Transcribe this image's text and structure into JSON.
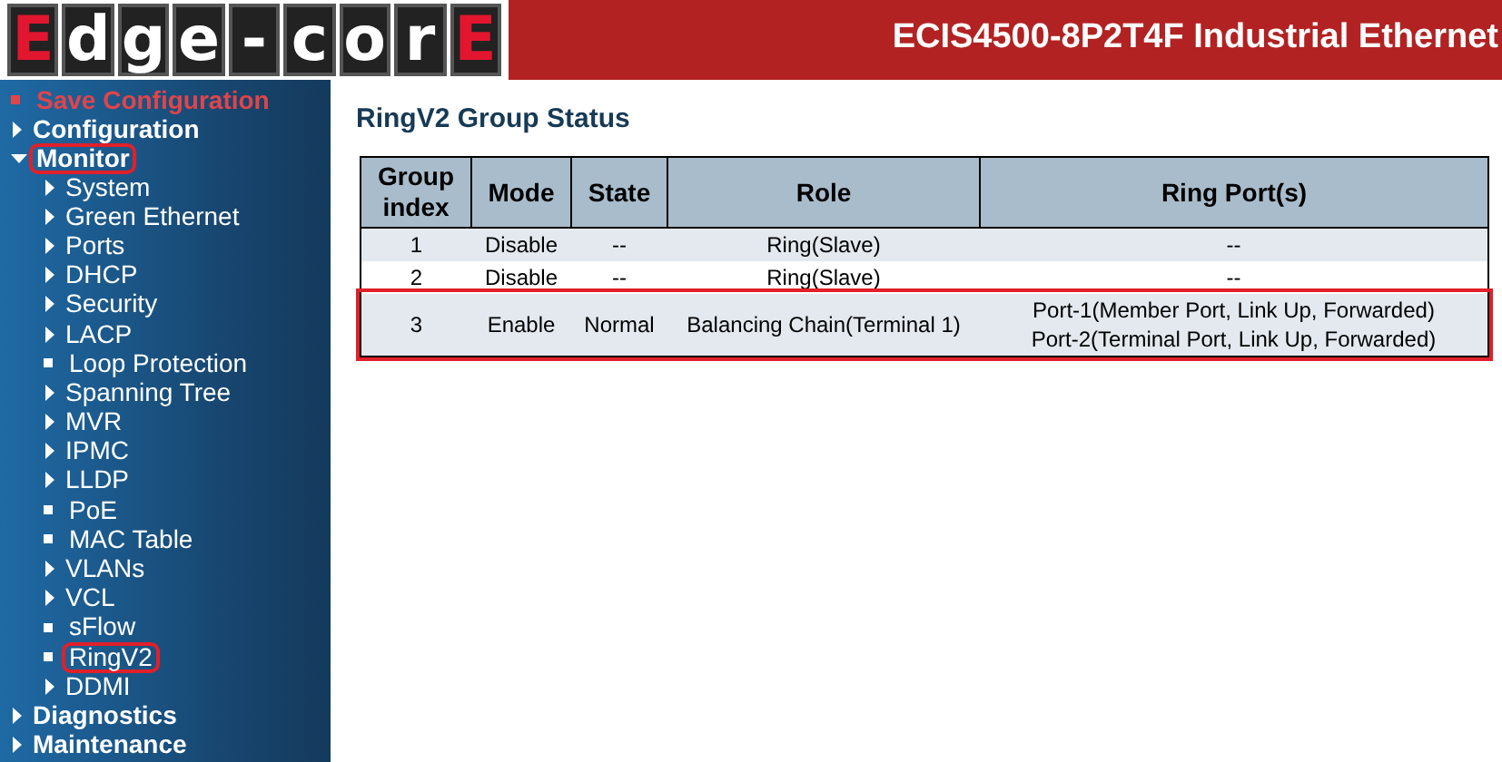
{
  "header": {
    "logo": [
      {
        "letter": "E",
        "accent": true
      },
      {
        "letter": "d",
        "accent": false
      },
      {
        "letter": "g",
        "accent": false
      },
      {
        "letter": "e",
        "accent": false
      },
      {
        "letter": "-",
        "accent": false
      },
      {
        "letter": "c",
        "accent": false
      },
      {
        "letter": "o",
        "accent": false
      },
      {
        "letter": "r",
        "accent": false
      },
      {
        "letter": "E",
        "accent": true
      }
    ],
    "title": "ECIS4500-8P2T4F Industrial Ethernet"
  },
  "sidebar": {
    "items": [
      {
        "label": "Save Configuration",
        "kind": "action",
        "highlighted": false
      },
      {
        "label": "Configuration",
        "kind": "folder",
        "expanded": false,
        "highlighted": false
      },
      {
        "label": "Monitor",
        "kind": "folder",
        "expanded": true,
        "highlighted": true,
        "children": [
          {
            "label": "System",
            "kind": "folder",
            "expanded": false,
            "highlighted": false
          },
          {
            "label": "Green Ethernet",
            "kind": "folder",
            "expanded": false,
            "highlighted": false
          },
          {
            "label": "Ports",
            "kind": "folder",
            "expanded": false,
            "highlighted": false
          },
          {
            "label": "DHCP",
            "kind": "folder",
            "expanded": false,
            "highlighted": false
          },
          {
            "label": "Security",
            "kind": "folder",
            "expanded": false,
            "highlighted": false
          },
          {
            "label": "LACP",
            "kind": "folder",
            "expanded": false,
            "highlighted": false
          },
          {
            "label": "Loop Protection",
            "kind": "page",
            "highlighted": false
          },
          {
            "label": "Spanning Tree",
            "kind": "folder",
            "expanded": false,
            "highlighted": false
          },
          {
            "label": "MVR",
            "kind": "folder",
            "expanded": false,
            "highlighted": false
          },
          {
            "label": "IPMC",
            "kind": "folder",
            "expanded": false,
            "highlighted": false
          },
          {
            "label": "LLDP",
            "kind": "folder",
            "expanded": false,
            "highlighted": false
          },
          {
            "label": "PoE",
            "kind": "page",
            "highlighted": false
          },
          {
            "label": "MAC Table",
            "kind": "page",
            "highlighted": false
          },
          {
            "label": "VLANs",
            "kind": "folder",
            "expanded": false,
            "highlighted": false
          },
          {
            "label": "VCL",
            "kind": "folder",
            "expanded": false,
            "highlighted": false
          },
          {
            "label": "sFlow",
            "kind": "page",
            "highlighted": false
          },
          {
            "label": "RingV2",
            "kind": "page",
            "highlighted": true
          },
          {
            "label": "DDMI",
            "kind": "folder",
            "expanded": false,
            "highlighted": false
          }
        ]
      },
      {
        "label": "Diagnostics",
        "kind": "folder",
        "expanded": false,
        "highlighted": false
      },
      {
        "label": "Maintenance",
        "kind": "folder",
        "expanded": false,
        "highlighted": false
      }
    ]
  },
  "page": {
    "title": "RingV2 Group Status",
    "table": {
      "columns": [
        "Group index",
        "Mode",
        "State",
        "Role",
        "Ring Port(s)"
      ],
      "rows": [
        {
          "cells": [
            "1",
            "Disable",
            "--",
            "Ring(Slave)",
            [
              "--"
            ]
          ],
          "highlighted": false
        },
        {
          "cells": [
            "2",
            "Disable",
            "--",
            "Ring(Slave)",
            [
              "--"
            ]
          ],
          "highlighted": false
        },
        {
          "cells": [
            "3",
            "Enable",
            "Normal",
            "Balancing Chain(Terminal 1)",
            [
              "Port-1(Member Port, Link Up, Forwarded)",
              "Port-2(Terminal Port, Link Up, Forwarded)"
            ]
          ],
          "highlighted": true
        }
      ]
    }
  }
}
